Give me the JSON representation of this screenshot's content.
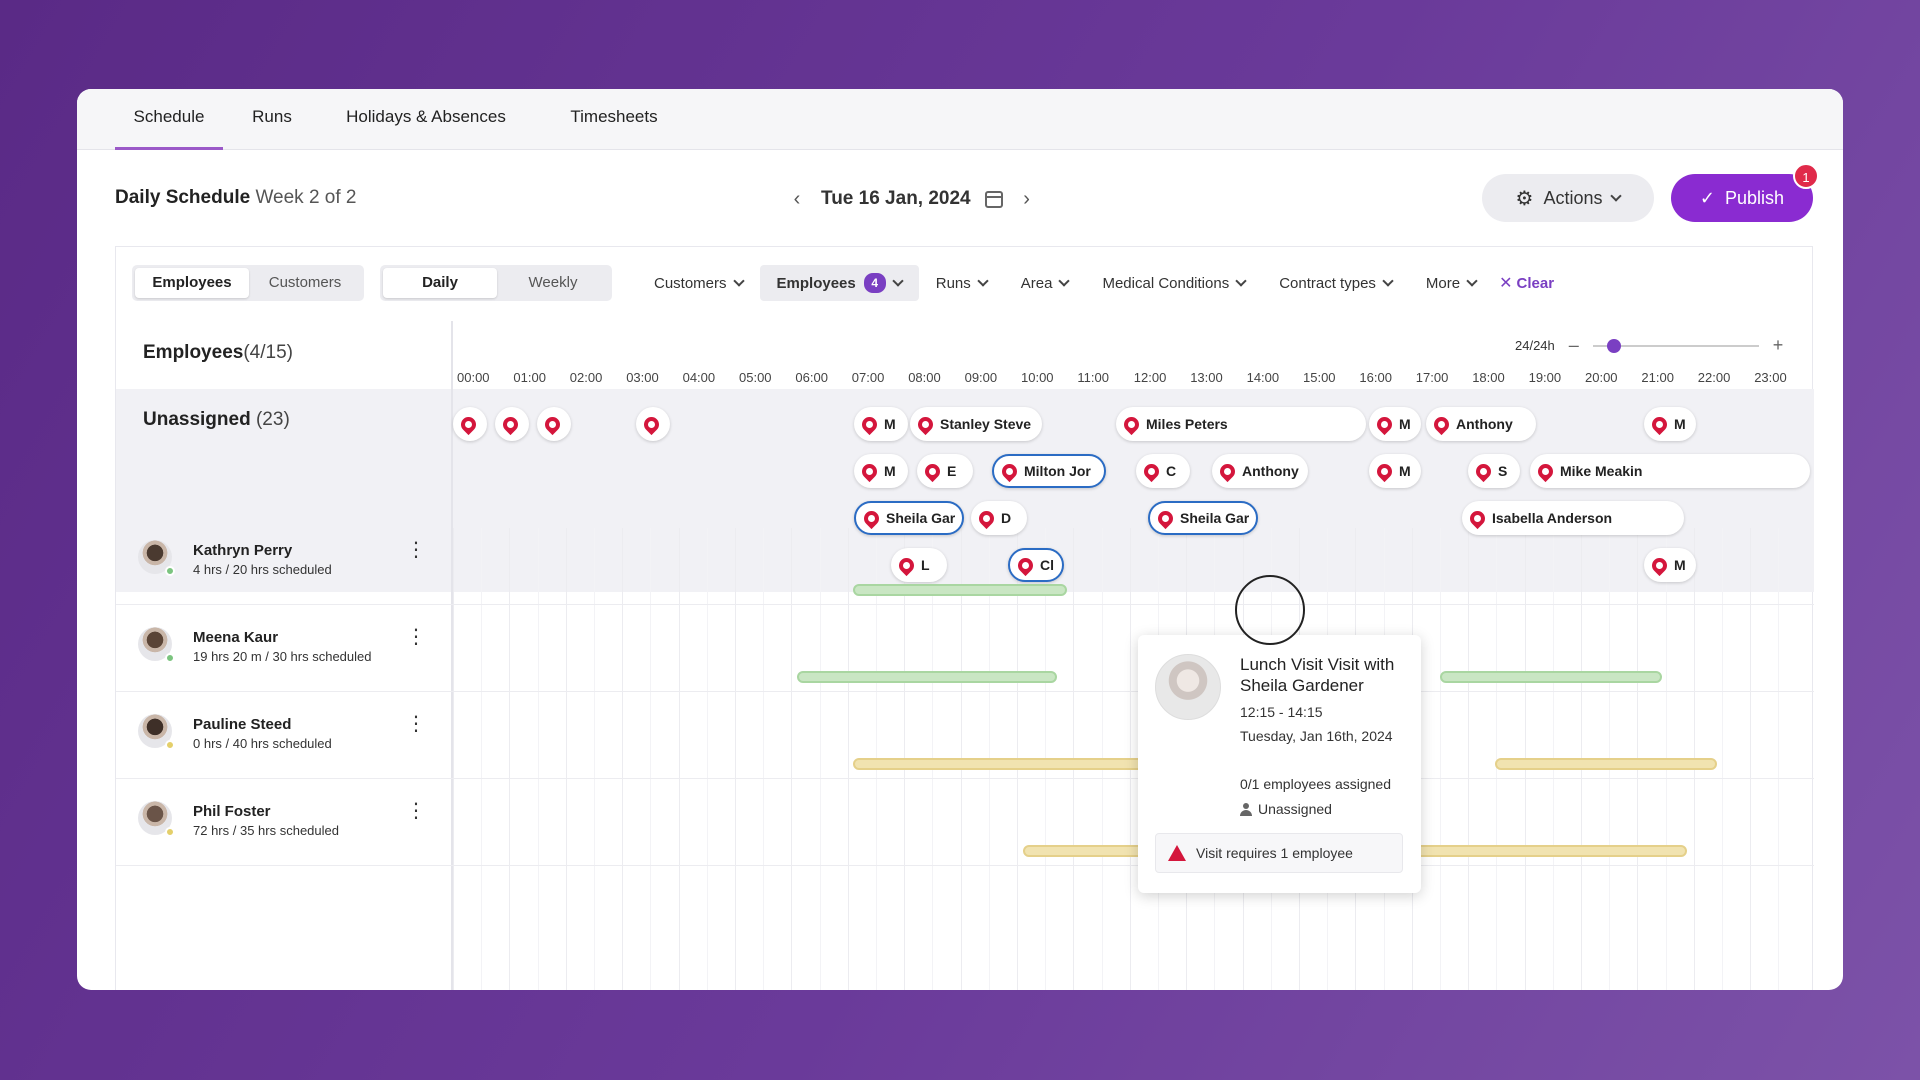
{
  "tabs": [
    "Schedule",
    "Runs",
    "Holidays & Absences",
    "Timesheets"
  ],
  "header": {
    "title": "Daily Schedule",
    "subtitle": "Week 2 of 2",
    "date": "Tue 16 Jan, 2024",
    "actions_label": "Actions",
    "publish_label": "Publish",
    "publish_badge": "1"
  },
  "toggles": {
    "view_by": [
      "Employees",
      "Customers"
    ],
    "range": [
      "Daily",
      "Weekly"
    ]
  },
  "filters": {
    "customers": "Customers",
    "employees": "Employees",
    "employees_count": "4",
    "runs": "Runs",
    "area": "Area",
    "medical": "Medical Conditions",
    "contract": "Contract types",
    "more": "More",
    "clear": "Clear"
  },
  "left": {
    "employees_label": "Employees",
    "employees_count": "(4/15)",
    "unassigned_label": "Unassigned",
    "unassigned_count": "(23)"
  },
  "zoom": {
    "label": "24/24h",
    "minus": "–",
    "plus": "+"
  },
  "hours": [
    "00:00",
    "01:00",
    "02:00",
    "03:00",
    "04:00",
    "05:00",
    "06:00",
    "07:00",
    "08:00",
    "09:00",
    "10:00",
    "11:00",
    "12:00",
    "13:00",
    "14:00",
    "15:00",
    "16:00",
    "17:00",
    "18:00",
    "19:00",
    "20:00",
    "21:00",
    "22:00",
    "23:00"
  ],
  "visits": [
    {
      "label": ""
    },
    {
      "label": ""
    },
    {
      "label": ""
    },
    {
      "label": ""
    },
    {
      "label": "M"
    },
    {
      "label": "Stanley Steve"
    },
    {
      "label": "Miles Peters"
    },
    {
      "label": "M"
    },
    {
      "label": "Anthony"
    },
    {
      "label": "M"
    },
    {
      "label": "M"
    },
    {
      "label": "E"
    },
    {
      "label": "Milton Jor"
    },
    {
      "label": "C"
    },
    {
      "label": "Anthony"
    },
    {
      "label": "M"
    },
    {
      "label": "S"
    },
    {
      "label": "Mike Meakin"
    },
    {
      "label": "Sheila Gar"
    },
    {
      "label": "D"
    },
    {
      "label": "Sheila Gar"
    },
    {
      "label": "Isabella Anderson"
    },
    {
      "label": "L"
    },
    {
      "label": "Cl"
    },
    {
      "label": "M"
    }
  ],
  "employees": [
    {
      "name": "Kathryn Perry",
      "hours": "4 hrs / 20 hrs scheduled",
      "status_color": "#7bc47f",
      "avatar_color": "#4a3a30"
    },
    {
      "name": "Meena Kaur",
      "hours": "19 hrs 20 m / 30 hrs scheduled",
      "status_color": "#7bc47f",
      "avatar_color": "#5a4436"
    },
    {
      "name": "Pauline Steed",
      "hours": "0 hrs / 40 hrs scheduled",
      "status_color": "#e4cf6a",
      "avatar_color": "#3e2f28"
    },
    {
      "name": "Phil Foster",
      "hours": "72 hrs / 35 hrs scheduled",
      "status_color": "#e4cf6a",
      "avatar_color": "#6a5448"
    }
  ],
  "tooltip": {
    "title": "Lunch Visit Visit with Sheila Gardener",
    "time": "12:15 - 14:15",
    "date": "Tuesday, Jan 16th, 2024",
    "assigned": "0/1 employees assigned",
    "status": "Unassigned",
    "warning": "Visit requires 1 employee"
  },
  "colors": {
    "accent": "#8a2bd1",
    "pin": "#d4163c",
    "bar_green": "#c9e6c3",
    "bar_yellow": "#f1e3b0"
  }
}
